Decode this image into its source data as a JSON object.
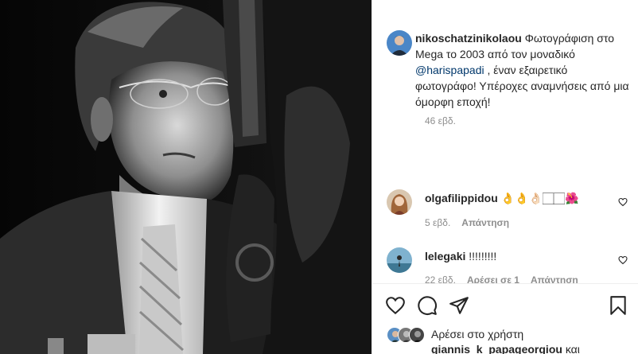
{
  "post": {
    "photo_alt": "Black and white portrait photograph"
  },
  "caption": {
    "username": "nikoschatzinikolaou",
    "text_before": " Φωτογράφιση στο Mega το 2003 από τον μοναδικό ",
    "mention": "@harispapadi",
    "text_after": " , έναν εξαιρετικό φωτογράφο! Υπέροχες αναμνήσεις από μια όμορφη εποχή!",
    "time": "46 εβδ."
  },
  "comments": [
    {
      "username": "olgafilippidou",
      "text": " 👌👌👌🏻🏻🏻🌺",
      "time": "5 εβδ.",
      "reply": "Απάντηση"
    },
    {
      "username": "lelegaki",
      "text": " !!!!!!!!!",
      "time": "22 εβδ.",
      "likes": "Αρέσει σε 1",
      "reply": "Απάντηση"
    }
  ],
  "likes": {
    "line1": "Αρέσει στο χρήστη",
    "user": "giannis_k_papageorgiou",
    "line2_suffix": " και"
  },
  "icons": {
    "like": "heart-icon",
    "comment": "comment-icon",
    "share": "share-icon",
    "save": "bookmark-icon"
  }
}
